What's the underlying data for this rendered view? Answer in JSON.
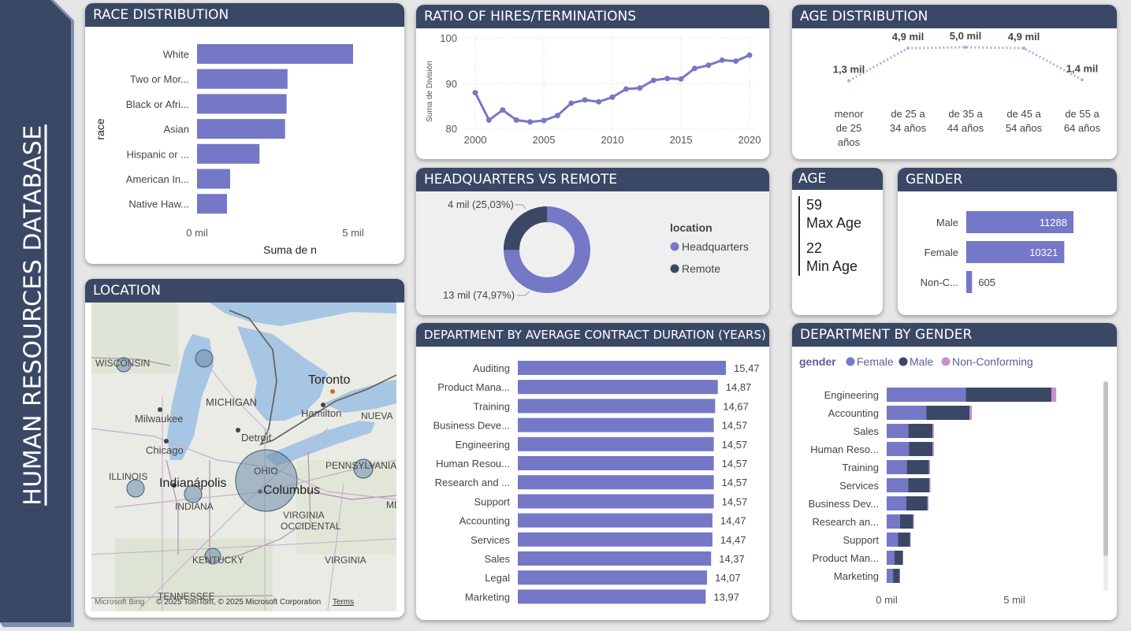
{
  "banner": {
    "title": "HUMAN RESOURCES DATABASE"
  },
  "colors": {
    "primary": "#7478c6",
    "dark": "#3a4866",
    "pink": "#c592cf",
    "header": "#3a4866"
  },
  "race": {
    "title": "RACE DISTRIBUTION",
    "y_title": "race",
    "x_title": "Suma de n",
    "ticks": [
      "0 mil",
      "5 mil"
    ]
  },
  "hires": {
    "title": "RATIO OF HIRES/TERMINATIONS",
    "y_title": "Suma de División",
    "y_ticks": [
      "100",
      "90",
      "80"
    ],
    "x_ticks": [
      "2000",
      "2005",
      "2010",
      "2015",
      "2020"
    ]
  },
  "age_dist": {
    "title": "AGE DISTRIBUTION"
  },
  "hq": {
    "title": "HEADQUARTERS VS REMOTE",
    "label_remote": "4 mil (25,03%)",
    "label_hq": "13 mil (74,97%)",
    "legend_title": "location",
    "legend": [
      "Headquarters",
      "Remote"
    ]
  },
  "age": {
    "title": "AGE",
    "max_value": "59",
    "max_label": "Max Age",
    "min_value": "22",
    "min_label": "Min Age"
  },
  "gender": {
    "title": "GENDER"
  },
  "location": {
    "title": "LOCATION",
    "labels": {
      "wisconsin": "WISCONSIN",
      "michigan": "MICHIGAN",
      "toronto": "Toronto",
      "hamilton": "Hamilton",
      "nueva": "NUEVA",
      "milwaukee": "Milwaukee",
      "detroit": "Detroit",
      "chicago": "Chicago",
      "ohio": "OHIO",
      "illinois": "ILLINOIS",
      "indianapolis": "Indianápolis",
      "columbus": "Columbus",
      "pennsylvania": "PENNSYLVANIA",
      "indiana": "INDIANA",
      "virginia_occ_1": "VIRGINIA",
      "virginia_occ_2": "OCCIDENTAL",
      "md": "MD",
      "kentucky": "KENTUCKY",
      "virginia": "VIRGINIA",
      "tennessee": "TENNESSEE"
    },
    "attribution": {
      "bing": "Microsoft Bing",
      "copyright": "© 2025 TomTom, © 2025 Microsoft Corporation",
      "terms": "Terms"
    }
  },
  "dept_duration": {
    "title": "DEPARTMENT BY AVERAGE CONTRACT DURATION (YEARS)"
  },
  "dept_gender": {
    "title": "DEPARTMENT BY GENDER",
    "legend_title": "gender",
    "legend": [
      "Female",
      "Male",
      "Non-Conforming"
    ],
    "ticks": [
      "0 mil",
      "5 mil"
    ]
  },
  "chart_data": [
    {
      "id": "race",
      "type": "bar",
      "orientation": "horizontal",
      "categories": [
        "White",
        "Two or Mor...",
        "Black or Afri...",
        "Asian",
        "Hispanic or ...",
        "American In...",
        "Native Haw..."
      ],
      "values": [
        5000,
        2900,
        2870,
        2820,
        2000,
        1060,
        960
      ],
      "xlim": [
        0,
        5000
      ],
      "xlabel": "Suma de n",
      "ylabel": "race"
    },
    {
      "id": "hires",
      "type": "line",
      "x": [
        2000,
        2001,
        2002,
        2003,
        2004,
        2005,
        2006,
        2007,
        2008,
        2009,
        2010,
        2011,
        2012,
        2013,
        2014,
        2015,
        2016,
        2017,
        2018,
        2019,
        2020
      ],
      "y": [
        88,
        82,
        84.2,
        82,
        81.6,
        81.9,
        83,
        85.7,
        86.4,
        86,
        87,
        88.8,
        89,
        90.7,
        91.1,
        91,
        93.3,
        94,
        95.1,
        94.9,
        96.2
      ],
      "ylim": [
        80,
        100
      ],
      "xlim": [
        2000,
        2020
      ],
      "ylabel": "Suma de División",
      "grid": true
    },
    {
      "id": "age_distribution",
      "type": "line",
      "categories": [
        "menor de 25 años",
        "de 25 a 34 años",
        "de 35 a 44 años",
        "de 45 a 54 años",
        "de 55 a 64 años"
      ],
      "values": [
        1300,
        4900,
        5000,
        4900,
        1400
      ],
      "data_labels": [
        "1,3 mil",
        "4,9 mil",
        "5,0 mil",
        "4,9 mil",
        "1,4 mil"
      ]
    },
    {
      "id": "headquarters_vs_remote",
      "type": "pie",
      "categories": [
        "Headquarters",
        "Remote"
      ],
      "values": [
        74.97,
        25.03
      ],
      "legend": "right"
    },
    {
      "id": "gender",
      "type": "bar",
      "orientation": "horizontal",
      "categories": [
        "Male",
        "Female",
        "Non-C..."
      ],
      "values": [
        11288,
        10321,
        605
      ],
      "data_labels": [
        "11288",
        "10321",
        "605"
      ]
    },
    {
      "id": "dept_duration",
      "type": "bar",
      "orientation": "horizontal",
      "categories": [
        "Auditing",
        "Product Mana...",
        "Training",
        "Business Deve...",
        "Engineering",
        "Human Resou...",
        "Research and ...",
        "Support",
        "Accounting",
        "Services",
        "Sales",
        "Legal",
        "Marketing"
      ],
      "values": [
        15.47,
        14.87,
        14.67,
        14.57,
        14.57,
        14.57,
        14.57,
        14.57,
        14.47,
        14.47,
        14.37,
        14.07,
        13.97
      ],
      "data_labels": [
        "15,47",
        "14,87",
        "14,67",
        "14,57",
        "14,57",
        "14,57",
        "14,57",
        "14,57",
        "14,47",
        "14,47",
        "14,37",
        "14,07",
        "13,97"
      ]
    },
    {
      "id": "dept_gender",
      "type": "bar",
      "orientation": "horizontal",
      "stacked": true,
      "categories": [
        "Engineering",
        "Accounting",
        "Sales",
        "Human Reso...",
        "Training",
        "Services",
        "Business Dev...",
        "Research an...",
        "Support",
        "Product Man...",
        "Marketing"
      ],
      "series": [
        {
          "name": "Female",
          "values": [
            3100,
            1550,
            850,
            870,
            790,
            840,
            770,
            520,
            440,
            300,
            250
          ]
        },
        {
          "name": "Male",
          "values": [
            3350,
            1700,
            950,
            930,
            870,
            830,
            830,
            520,
            480,
            330,
            260
          ]
        },
        {
          "name": "Non-Conforming",
          "values": [
            190,
            90,
            50,
            50,
            40,
            50,
            40,
            30,
            20,
            20,
            10
          ]
        }
      ],
      "xlim": [
        0,
        5000
      ],
      "legend": "top-left"
    }
  ]
}
